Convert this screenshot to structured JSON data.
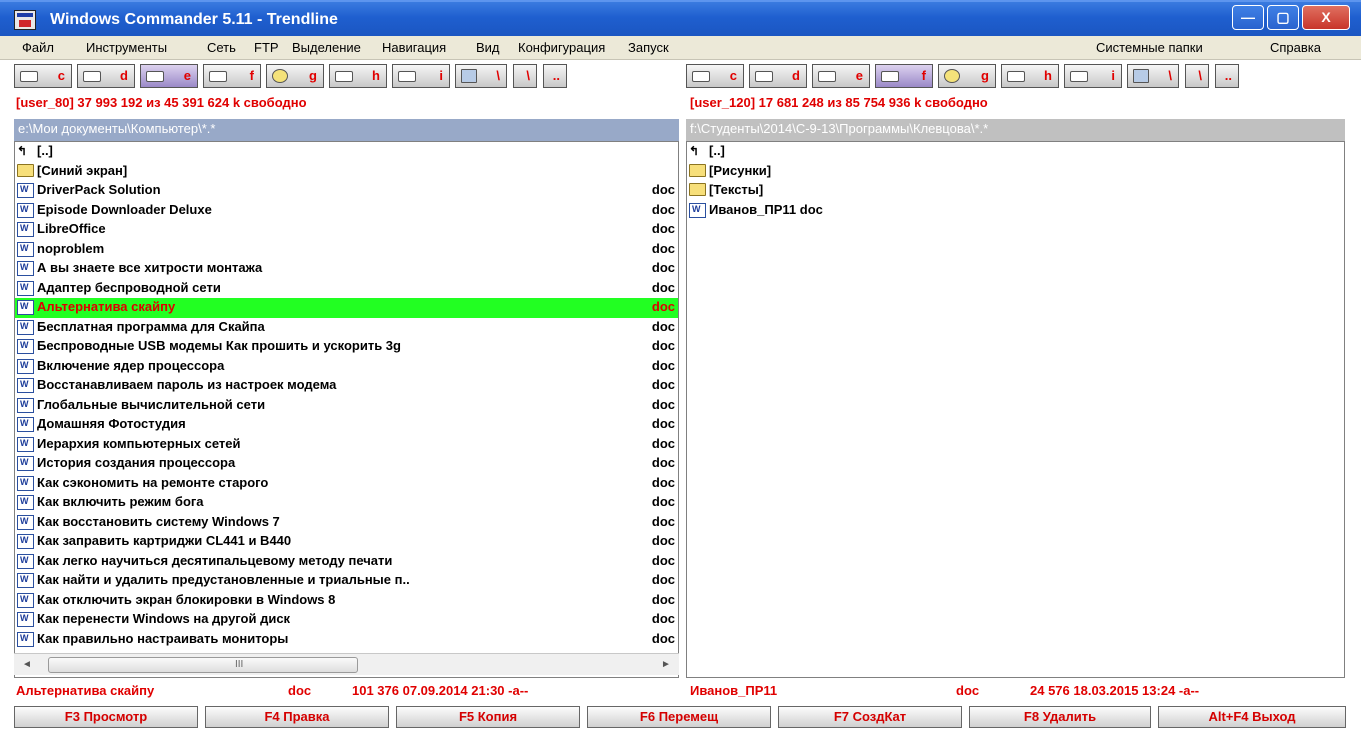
{
  "window": {
    "title": "Windows Commander 5.11 - Trendline",
    "minimize": "—",
    "maximize": "▢",
    "close": "X"
  },
  "menu": {
    "items": [
      "Файл",
      "Инструменты",
      "Сеть",
      "FTP",
      "Выделение",
      "Навигация",
      "Вид",
      "Конфигурация",
      "Запуск"
    ],
    "right_items": [
      "Системные папки",
      "Справка"
    ]
  },
  "drives": {
    "letters": [
      "c",
      "d",
      "e",
      "f",
      "g",
      "h",
      "i"
    ],
    "root_label": "\\",
    "up_label": ".."
  },
  "left_panel": {
    "free_space": "[user_80]  37 993 192 из 45 391 624 k свободно",
    "path": "e:\\Мои документы\\Компьютер\\*.*",
    "files": [
      {
        "type": "up",
        "name": "[..]",
        "ext": ""
      },
      {
        "type": "folder",
        "name": "[Синий экран]",
        "ext": ""
      },
      {
        "type": "doc",
        "name": "DriverPack Solution",
        "ext": "doc"
      },
      {
        "type": "doc",
        "name": "Episode Downloader Deluxe",
        "ext": "doc"
      },
      {
        "type": "doc",
        "name": "LibreOffice",
        "ext": "doc"
      },
      {
        "type": "doc",
        "name": "noproblem",
        "ext": "doc"
      },
      {
        "type": "doc",
        "name": "А вы знаете все хитрости монтажа",
        "ext": "doc"
      },
      {
        "type": "doc",
        "name": "Адаптер беспроводной сети",
        "ext": "doc"
      },
      {
        "type": "doc",
        "name": "Альтернатива скайпу",
        "ext": "doc",
        "active": true
      },
      {
        "type": "doc",
        "name": "Бесплатная программа для Скайпа",
        "ext": "doc"
      },
      {
        "type": "doc",
        "name": "Беспроводные USB модемы Как прошить и ускорить 3g",
        "ext": "doc"
      },
      {
        "type": "doc",
        "name": "Включение ядер процессора",
        "ext": "doc"
      },
      {
        "type": "doc",
        "name": "Восстанавливаем пароль из настроек модема",
        "ext": "doc"
      },
      {
        "type": "doc",
        "name": "Глобальные вычислительной сети",
        "ext": "doc"
      },
      {
        "type": "doc",
        "name": "Домашняя Фотостудия",
        "ext": "doc"
      },
      {
        "type": "doc",
        "name": "Иерархия компьютерных сетей",
        "ext": "doc"
      },
      {
        "type": "doc",
        "name": "История создания процессора",
        "ext": "doc"
      },
      {
        "type": "doc",
        "name": "Как  сэкономить на ремонте старого",
        "ext": "doc"
      },
      {
        "type": "doc",
        "name": "Как включить режим бога",
        "ext": "doc"
      },
      {
        "type": "doc",
        "name": "Как восстановить систему Windows 7",
        "ext": "doc"
      },
      {
        "type": "doc",
        "name": "Как заправить картриджи CL441 и B440",
        "ext": "doc"
      },
      {
        "type": "doc",
        "name": "Как легко научиться десятипальцевому методу печати",
        "ext": "doc"
      },
      {
        "type": "doc",
        "name": "Как найти и удалить предустановленные и триальные п..",
        "ext": "doc"
      },
      {
        "type": "doc",
        "name": "Как отключить экран блокировки в Windows 8",
        "ext": "doc"
      },
      {
        "type": "doc",
        "name": "Как перенести Windows на другой диск",
        "ext": "doc"
      },
      {
        "type": "doc",
        "name": "Как правильно настраивать мониторы",
        "ext": "doc"
      }
    ],
    "status": {
      "name": "Альтернатива скайпу",
      "ext": "doc",
      "info": "101 376 07.09.2014 21:30 -a--"
    }
  },
  "right_panel": {
    "free_space": "[user_120]  17 681 248 из 85 754 936 k свободно",
    "path": "f:\\Студенты\\2014\\С-9-13\\Программы\\Клевцова\\*.*",
    "files": [
      {
        "type": "up",
        "name": "[..]",
        "ext": ""
      },
      {
        "type": "folder",
        "name": "[Рисунки]",
        "ext": ""
      },
      {
        "type": "folder",
        "name": "[Тексты]",
        "ext": ""
      },
      {
        "type": "doc",
        "name": "Иванов_ПР11 doc",
        "ext": ""
      }
    ],
    "status": {
      "name": "Иванов_ПР11",
      "ext": "doc",
      "info": "24 576 18.03.2015 13:24 -a--"
    }
  },
  "scrollbar": {
    "left_arrow": "◄",
    "right_arrow": "►",
    "grip": "III"
  },
  "fkeys": [
    "F3 Просмотр",
    "F4 Правка",
    "F5 Копия",
    "F6 Перемещ",
    "F7 СоздКат",
    "F8 Удалить",
    "Alt+F4 Выход"
  ]
}
